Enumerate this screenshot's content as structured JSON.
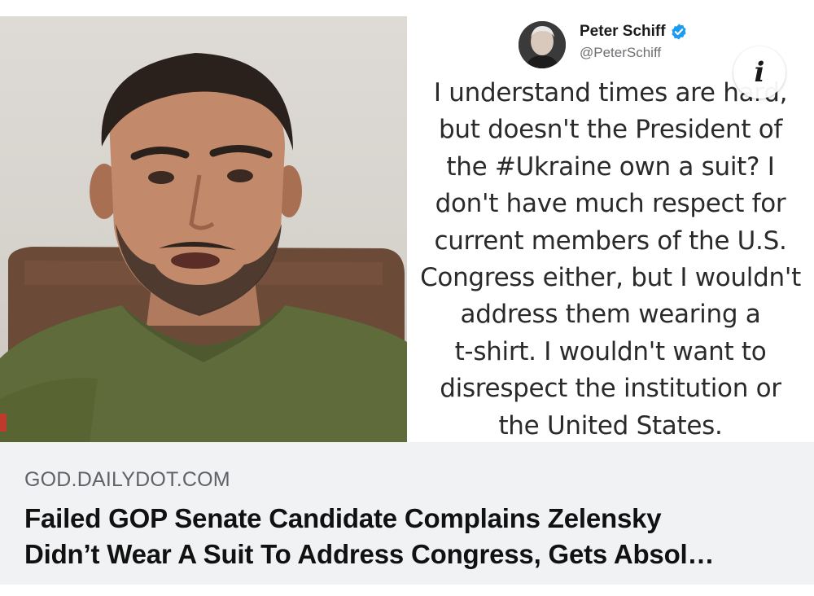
{
  "media": {
    "photo_alt": "",
    "tweet": {
      "author_name": "Peter Schiff",
      "author_handle": "@PeterSchiff",
      "verified": true,
      "text_lines": [
        "I understand times are hard,",
        "but doesn't the President of",
        "the #Ukraine own a suit? I",
        "don't have much respect for",
        "current members of the U.S.",
        "Congress either, but I wouldn't",
        "address them wearing a",
        "t-shirt. I wouldn't want to",
        "disrespect the institution or",
        "the United States."
      ]
    },
    "info_icon": "i"
  },
  "caption": {
    "source": "GOD.DAILYDOT.COM",
    "headline_lines": [
      "Failed GOP Senate Candidate Complains Zelensky",
      "Didn’t Wear A Suit To Address Congress, Gets Absol…"
    ]
  },
  "colors": {
    "caption_bg": "#f1f2f4",
    "verified_blue": "#1d9bf0",
    "shirt_green": "#5f6b3a"
  }
}
